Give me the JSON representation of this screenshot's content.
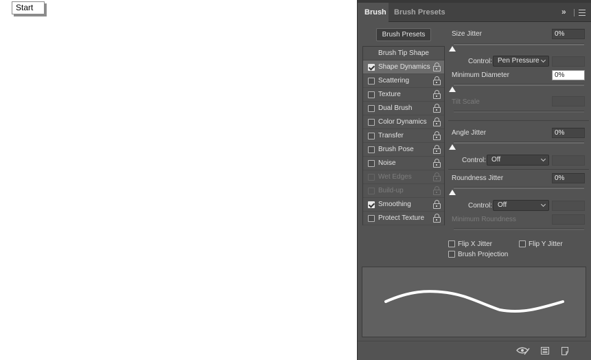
{
  "taskbar": {
    "start_label": "Start"
  },
  "panel": {
    "tabs": [
      {
        "label": "Brush",
        "active": true
      },
      {
        "label": "Brush Presets",
        "active": false
      }
    ],
    "collapse_glyph": "»",
    "menu_icon": "hamburger-menu-icon",
    "presets_button": "Brush Presets",
    "options_header": "Brush Tip Shape",
    "options": [
      {
        "label": "Shape Dynamics",
        "checked": true,
        "enabled": true,
        "selected": true
      },
      {
        "label": "Scattering",
        "checked": false,
        "enabled": true
      },
      {
        "label": "Texture",
        "checked": false,
        "enabled": true
      },
      {
        "label": "Dual Brush",
        "checked": false,
        "enabled": true
      },
      {
        "label": "Color Dynamics",
        "checked": false,
        "enabled": true
      },
      {
        "label": "Transfer",
        "checked": false,
        "enabled": true
      },
      {
        "label": "Brush Pose",
        "checked": false,
        "enabled": true
      },
      {
        "label": "Noise",
        "checked": false,
        "enabled": true
      },
      {
        "label": "Wet Edges",
        "checked": false,
        "enabled": false
      },
      {
        "label": "Build-up",
        "checked": false,
        "enabled": false
      },
      {
        "label": "Smoothing",
        "checked": true,
        "enabled": true
      },
      {
        "label": "Protect Texture",
        "checked": false,
        "enabled": true
      }
    ],
    "size_jitter": {
      "label": "Size Jitter",
      "value": "0%",
      "control_label": "Control:",
      "control_value": "Pen Pressure"
    },
    "minimum_diameter": {
      "label": "Minimum Diameter",
      "value": "0%"
    },
    "tilt_scale": {
      "label": "Tilt Scale",
      "value": ""
    },
    "angle_jitter": {
      "label": "Angle Jitter",
      "value": "0%",
      "control_label": "Control:",
      "control_value": "Off"
    },
    "roundness_jitter": {
      "label": "Roundness Jitter",
      "value": "0%",
      "control_label": "Control:",
      "control_value": "Off"
    },
    "minimum_roundness": {
      "label": "Minimum Roundness",
      "value": ""
    },
    "checkboxes": {
      "flip_x": {
        "label": "Flip X Jitter",
        "checked": false
      },
      "flip_y": {
        "label": "Flip Y Jitter",
        "checked": false
      },
      "brush_projection": {
        "label": "Brush Projection",
        "checked": false
      }
    },
    "bottom_icons": [
      "eye-toggle-icon",
      "brush-panel-icon",
      "new-brush-icon"
    ]
  },
  "colors": {
    "panel_bg": "#535353",
    "tabbar_bg": "#424242",
    "selected_row": "#6b6b6b",
    "preview_bg": "#606060",
    "stroke": "#ffffff"
  }
}
